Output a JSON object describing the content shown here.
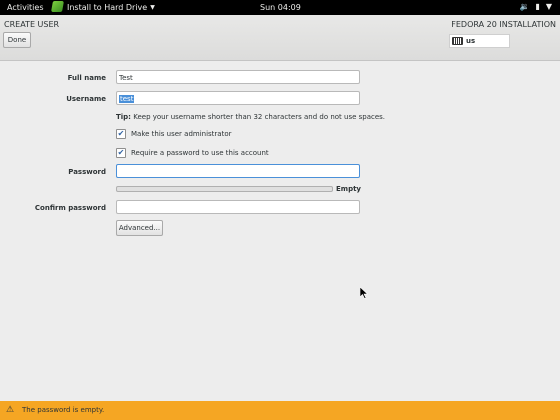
{
  "topbar": {
    "activities": "Activities",
    "app_menu": "Install to Hard Drive",
    "clock": "Sun 04:09",
    "icons": [
      "volume-icon",
      "battery-icon",
      "power-menu-icon"
    ]
  },
  "header": {
    "title": "CREATE USER",
    "install_title": "FEDORA 20 INSTALLATION",
    "done_label": "Done",
    "keyboard_layout": "us"
  },
  "form": {
    "full_name_label": "Full name",
    "full_name_value": "Test",
    "username_label": "Username",
    "username_value": "test",
    "tip_prefix": "Tip:",
    "tip_text": " Keep your username shorter than 32 characters and do not use spaces.",
    "admin_label": "Make this user administrator",
    "admin_checked": true,
    "require_password_label": "Require a password to use this account",
    "require_password_checked": true,
    "password_label": "Password",
    "password_value": "",
    "strength_label": "Empty",
    "strength_level": 0,
    "confirm_label": "Confirm password",
    "confirm_value": "",
    "advanced_label": "Advanced..."
  },
  "warning": {
    "text": "The password is empty."
  },
  "colors": {
    "warning_bar": "#f5a623",
    "selection": "#4a90d9",
    "topbar": "#000000"
  }
}
